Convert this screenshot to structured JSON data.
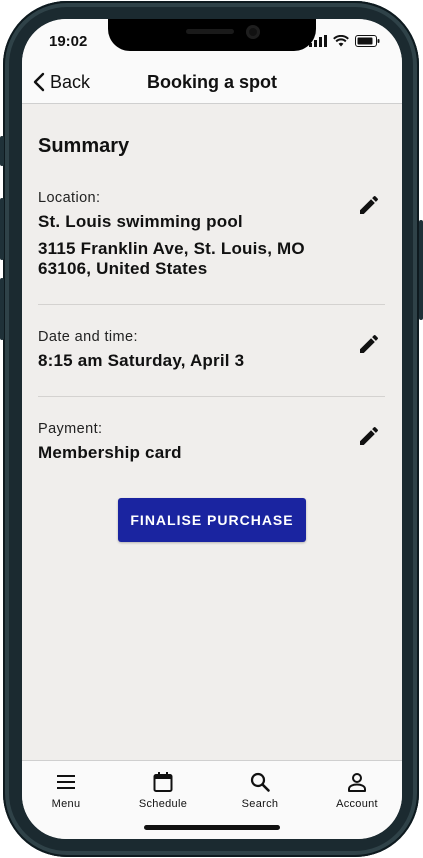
{
  "status_bar": {
    "time": "19:02"
  },
  "header": {
    "back_label": "Back",
    "title": "Booking a spot"
  },
  "summary": {
    "title": "Summary",
    "location": {
      "label": "Location:",
      "name": "St. Louis swimming pool",
      "address_line1": "3115 Franklin Ave, St. Louis, MO",
      "address_line2": "63106, United States"
    },
    "datetime": {
      "label": "Date and time:",
      "value": "8:15 am Saturday, April 3"
    },
    "payment": {
      "label": "Payment:",
      "value": "Membership card"
    }
  },
  "cta": {
    "label": "FINALISE PURCHASE"
  },
  "nav": {
    "items": [
      {
        "label": "Menu",
        "icon": "menu-icon"
      },
      {
        "label": "Schedule",
        "icon": "calendar-icon"
      },
      {
        "label": "Search",
        "icon": "search-icon"
      },
      {
        "label": "Account",
        "icon": "account-icon"
      }
    ]
  },
  "colors": {
    "accent": "#1a24a0",
    "background": "#f0eeec",
    "bar": "#fafafa"
  }
}
